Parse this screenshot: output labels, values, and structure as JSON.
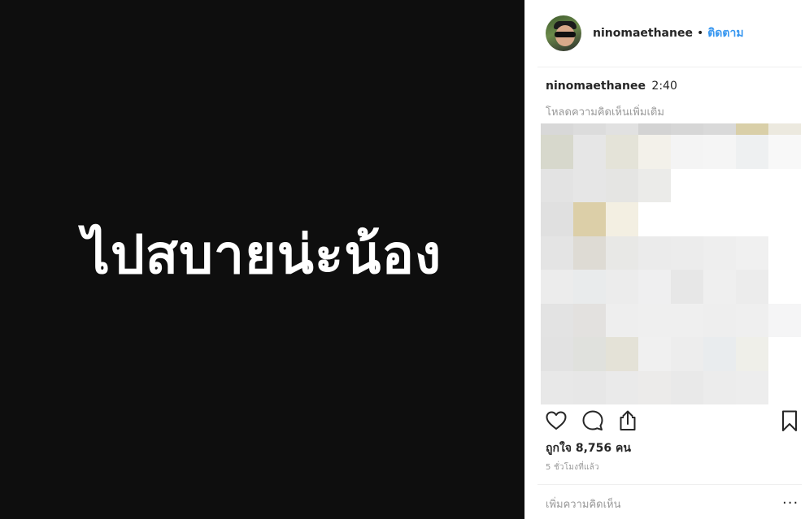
{
  "post": {
    "media_text": "ไปสบายน่ะน้อง"
  },
  "header": {
    "username": "ninomaethanee",
    "separator": "•",
    "follow_label": "ติดตาม",
    "avatar_icon": "avatar-photo"
  },
  "caption": {
    "username": "ninomaethanee",
    "text": "2:40"
  },
  "comments": {
    "load_more_label": "โหลดความคิดเห็นเพิ่มเติม"
  },
  "actions": {
    "like_icon": "heart-outline-icon",
    "comment_icon": "comment-bubble-icon",
    "share_icon": "share-upload-icon",
    "save_icon": "bookmark-outline-icon"
  },
  "likes_text": "ถูกใจ 8,756 คน",
  "time_ago": "5 ชั่วโมงที่แล้ว",
  "comment_box": {
    "placeholder": "เพิ่มความคิดเห็น",
    "more_label": "..."
  },
  "colors": {
    "link_blue": "#3897f0",
    "media_background": "#0e0e0e",
    "muted_text": "#999999",
    "text": "#262626"
  }
}
